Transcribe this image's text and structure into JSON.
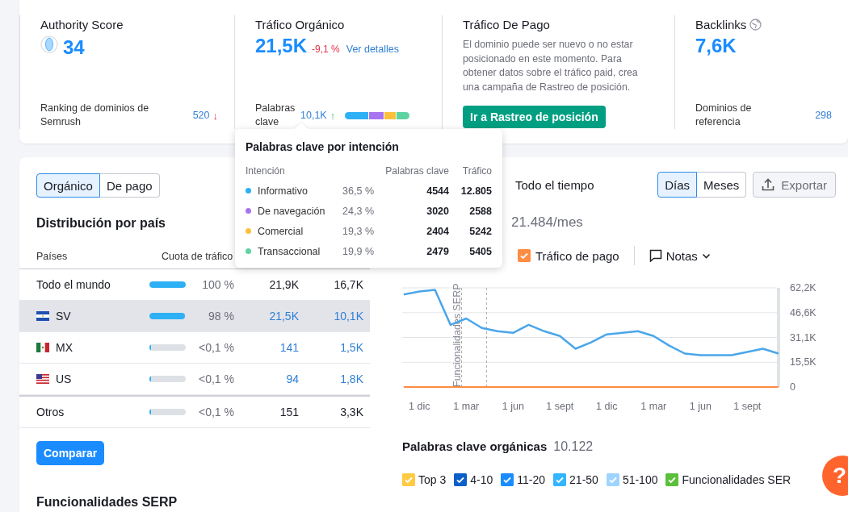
{
  "metrics": [
    {
      "kind": "score",
      "title": "Authority Score",
      "value": "34",
      "footer_label": "Ranking de dominios de Semrush",
      "footer_value": "520",
      "footer_trend": "↓"
    },
    {
      "kind": "traffic",
      "title": "Tráfico Orgánico",
      "value": "21,5K",
      "change": "-9,1 %",
      "link": "Ver detalles",
      "footer_label": "Palabras clave",
      "footer_value": "10,1K",
      "footer_trend": "↑",
      "intent_bar": [
        {
          "color": "#2eb0f5"
        },
        {
          "color": "#a875f0"
        },
        {
          "color": "#fbc13c"
        },
        {
          "color": "#5fd3a0"
        }
      ]
    },
    {
      "kind": "message",
      "title": "Tráfico De Pago",
      "text": "El dominio puede ser nuevo o no estar posicionado en este momento. Para obtener datos sobre el tráfico paid, crea una campaña de Rastreo de posición.",
      "button": "Ir a Rastreo de posición"
    },
    {
      "kind": "backlinks",
      "title": "Backlinks",
      "value": "7,6K",
      "footer_label": "Dominios de referencia",
      "footer_value": "298"
    }
  ],
  "intent_tooltip": {
    "title": "Palabras clave por intención",
    "columns": [
      "Intención",
      "Palabras clave",
      "Tráfico"
    ],
    "rows": [
      {
        "name": "Informativo",
        "color": "#2eb0f5",
        "share": "36,5 %",
        "keywords": "4544",
        "traffic": "12.805"
      },
      {
        "name": "De navegación",
        "color": "#a875f0",
        "share": "24,3 %",
        "keywords": "3020",
        "traffic": "2588"
      },
      {
        "name": "Comercial",
        "color": "#fbc13c",
        "share": "19,3 %",
        "keywords": "2404",
        "traffic": "5242"
      },
      {
        "name": "Transaccional",
        "color": "#5fd3a0",
        "share": "19,9 %",
        "keywords": "2479",
        "traffic": "5405"
      }
    ]
  },
  "traffic_tabs": [
    {
      "label": "Orgánico",
      "selected": true
    },
    {
      "label": "De pago",
      "selected": false
    }
  ],
  "country_distribution": {
    "title": "Distribución por país",
    "columns": [
      "Países",
      "Cuota de tráfico"
    ],
    "rows": [
      {
        "kind": "world",
        "name": "Todo el mundo",
        "level": 1,
        "share": "100 %",
        "column_3": "21,9K",
        "column_4": "16,7K",
        "linked": false,
        "selected": false
      },
      {
        "kind": "sv",
        "name": "SV",
        "level": 0.98,
        "share": "98 %",
        "column_3": "21,5K",
        "column_4": "10,1K",
        "linked": true,
        "selected": true
      },
      {
        "kind": "mx",
        "name": "MX",
        "level": 0.001,
        "share": "<0,1 %",
        "column_3": "141",
        "column_4": "1,5K",
        "linked": true,
        "selected": false
      },
      {
        "kind": "us",
        "name": "US",
        "level": 0.001,
        "share": "<0,1 %",
        "column_3": "94",
        "column_4": "1,8K",
        "linked": true,
        "selected": false
      },
      {
        "kind": "others",
        "name": "Otros",
        "level": 0.001,
        "share": "<0,1 %",
        "column_3": "151",
        "column_4": "3,3K",
        "linked": false,
        "selected": false
      }
    ]
  },
  "compare_button": "Comparar",
  "serp_title": "Funcionalidades SERP",
  "traffic_chart": {
    "period": "Todo el tiempo",
    "granularity": [
      {
        "label": "Días",
        "selected": true
      },
      {
        "label": "Meses",
        "selected": false
      }
    ],
    "export": "Exportar",
    "average": "21.484/mes",
    "legend": [
      {
        "label": "Tráfico de pago",
        "checked": true,
        "color": "#ff8c42"
      }
    ],
    "notes": "Notas",
    "chart_data": {
      "type": "line",
      "categories": [
        null,
        "1 dic",
        null,
        null,
        "1 mar",
        null,
        null,
        "1 jun",
        null,
        null,
        "1 sept",
        null,
        null,
        "1 dic",
        null,
        null,
        "1 mar",
        null,
        null,
        "1 jun",
        null,
        null,
        "1 sept",
        null,
        null
      ],
      "ylim": [
        0,
        62200
      ],
      "yticks": [
        {
          "value": 0,
          "label": "0"
        },
        {
          "value": 15500,
          "label": "15,5K"
        },
        {
          "value": 31100,
          "label": "31,1K"
        },
        {
          "value": 46600,
          "label": "46,6K"
        },
        {
          "value": 62200,
          "label": "62,2K"
        }
      ],
      "series": [
        {
          "color": "#4aa6ea",
          "values": [
            58000,
            60000,
            61000,
            39000,
            43000,
            37000,
            35000,
            34000,
            39000,
            35000,
            32000,
            24000,
            28000,
            33000,
            34000,
            35000,
            32000,
            26000,
            21000,
            20000,
            20000,
            20000,
            22000,
            24000,
            21000
          ]
        },
        {
          "color": "#ff8c42",
          "values": [
            0,
            0,
            0,
            0,
            0,
            0,
            0,
            0,
            0,
            0,
            0,
            0,
            0,
            0,
            0,
            0,
            0,
            0,
            0,
            0,
            0,
            0,
            0,
            0,
            0
          ]
        }
      ],
      "grid": true,
      "annotations": [
        "Funcionalidades SERP"
      ]
    }
  },
  "organic_keywords": {
    "title": "Palabras clave orgánicas",
    "count": "10.122",
    "filters": [
      {
        "label": "Top 3",
        "checked": true,
        "color": "#ffcb45"
      },
      {
        "label": "4-10",
        "checked": true,
        "color": "#0b5fc8"
      },
      {
        "label": "11-20",
        "checked": true,
        "color": "#1a8cff"
      },
      {
        "label": "21-50",
        "checked": true,
        "color": "#33b5ff"
      },
      {
        "label": "51-100",
        "checked": true,
        "color": "#9ed4ff"
      },
      {
        "label": "Funcionalidades SER",
        "checked": true,
        "color": "#5bbf3c"
      }
    ]
  },
  "help_button": "?"
}
